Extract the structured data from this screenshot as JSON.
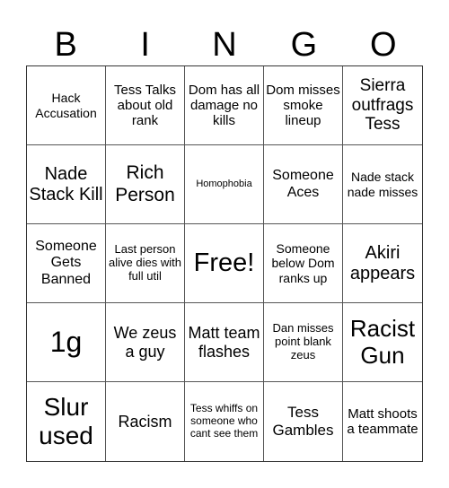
{
  "header": {
    "letters": [
      "B",
      "I",
      "N",
      "G",
      "O"
    ]
  },
  "cells": [
    {
      "text": "Hack Accusation",
      "size": 14
    },
    {
      "text": "Tess Talks about old rank",
      "size": 15
    },
    {
      "text": "Dom has all damage no kills",
      "size": 15
    },
    {
      "text": "Dom misses smoke lineup",
      "size": 15
    },
    {
      "text": "Sierra outfrags Tess",
      "size": 19
    },
    {
      "text": "Nade Stack Kill",
      "size": 20
    },
    {
      "text": "Rich Person",
      "size": 21
    },
    {
      "text": "Homophobia",
      "size": 11
    },
    {
      "text": "Someone Aces",
      "size": 16
    },
    {
      "text": "Nade stack nade misses",
      "size": 14
    },
    {
      "text": "Someone Gets Banned",
      "size": 16
    },
    {
      "text": "Last person alive dies with full util",
      "size": 13
    },
    {
      "text": "Free!",
      "size": 29
    },
    {
      "text": "Someone below Dom ranks up",
      "size": 14
    },
    {
      "text": "Akiri appears",
      "size": 20
    },
    {
      "text": "1g",
      "size": 32
    },
    {
      "text": "We zeus a guy",
      "size": 18
    },
    {
      "text": "Matt team flashes",
      "size": 18
    },
    {
      "text": "Dan misses point blank zeus",
      "size": 13
    },
    {
      "text": "Racist Gun",
      "size": 26
    },
    {
      "text": "Slur used",
      "size": 28
    },
    {
      "text": "Racism",
      "size": 18
    },
    {
      "text": "Tess whiffs on someone who cant see them",
      "size": 12
    },
    {
      "text": "Tess Gambles",
      "size": 17
    },
    {
      "text": "Matt shoots a teammate",
      "size": 15
    }
  ]
}
